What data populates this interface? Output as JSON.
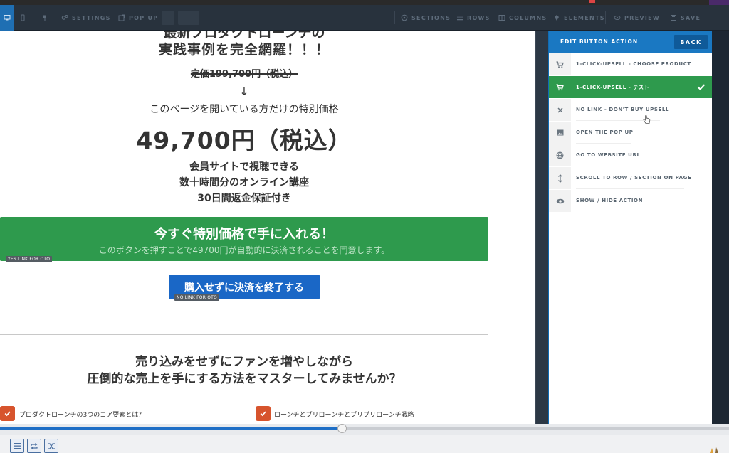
{
  "toolbar": {
    "settings": "SETTINGS",
    "popup": "POP UP",
    "sections": "SECTIONS",
    "rows": "ROWS",
    "columns": "COLUMNS",
    "elements": "ELEMENTS",
    "preview": "PREVIEW",
    "save": "SAVE"
  },
  "page": {
    "heading_cut": "最新プロダクトローンチの",
    "heading": "実践事例を完全網羅！！！",
    "regular_price": "定価199,700円（税込）",
    "arrow": "↓",
    "special_note": "このページを開いている方だけの特別価格",
    "price": "49,700円（税込）",
    "features": [
      "会員サイトで視聴できる",
      "数十時間分のオンライン講座",
      "30日間返金保証付き"
    ],
    "cta_title": "今すぐ特別価格で手に入れる！",
    "cta_sub": "このボタンを押すことで49700円が自動的に決済されることを同意します。",
    "cta_tag": "YES LINK FOR OTO",
    "decline_label": "購入せずに決済を終了する",
    "decline_tag": "NO LINK FOR OTO",
    "section_heading_1": "売り込みをせずにファンを増やしながら",
    "section_heading_2": "圧倒的な売上を手にする方法をマスターしてみませんか？",
    "checklist": [
      "プロダクトローンチの3つのコア要素とは？",
      "ローンチとプリローンチとプリプリローンチ戦略"
    ]
  },
  "panel": {
    "title": "EDIT BUTTON ACTION",
    "back": "BACK",
    "options": [
      {
        "label": "1-CLICK-UPSELL - CHOOSE PRODUCT",
        "icon": "cart-icon",
        "active": false
      },
      {
        "label": "1-CLICK-UPSELL - テスト",
        "icon": "cart-icon",
        "active": true
      },
      {
        "label": "NO LINK - DON'T BUY UPSELL",
        "icon": "close-icon",
        "active": false
      },
      {
        "label": "OPEN THE POP UP",
        "icon": "image-icon",
        "active": false
      },
      {
        "label": "GO TO WEBSITE URL",
        "icon": "globe-icon",
        "active": false
      },
      {
        "label": "SCROLL TO ROW / SECTION ON PAGE",
        "icon": "vertical-arrows-icon",
        "active": false
      },
      {
        "label": "SHOW / HIDE ACTION",
        "icon": "eye-icon",
        "active": false
      }
    ]
  },
  "player": {
    "progress_percent": 47
  },
  "colors": {
    "accent_blue": "#1a78c2",
    "cta_green": "#2e9a4d",
    "price_red": "#d9362b",
    "heading_blue": "#1f78c8",
    "check_orange": "#d7542d"
  }
}
